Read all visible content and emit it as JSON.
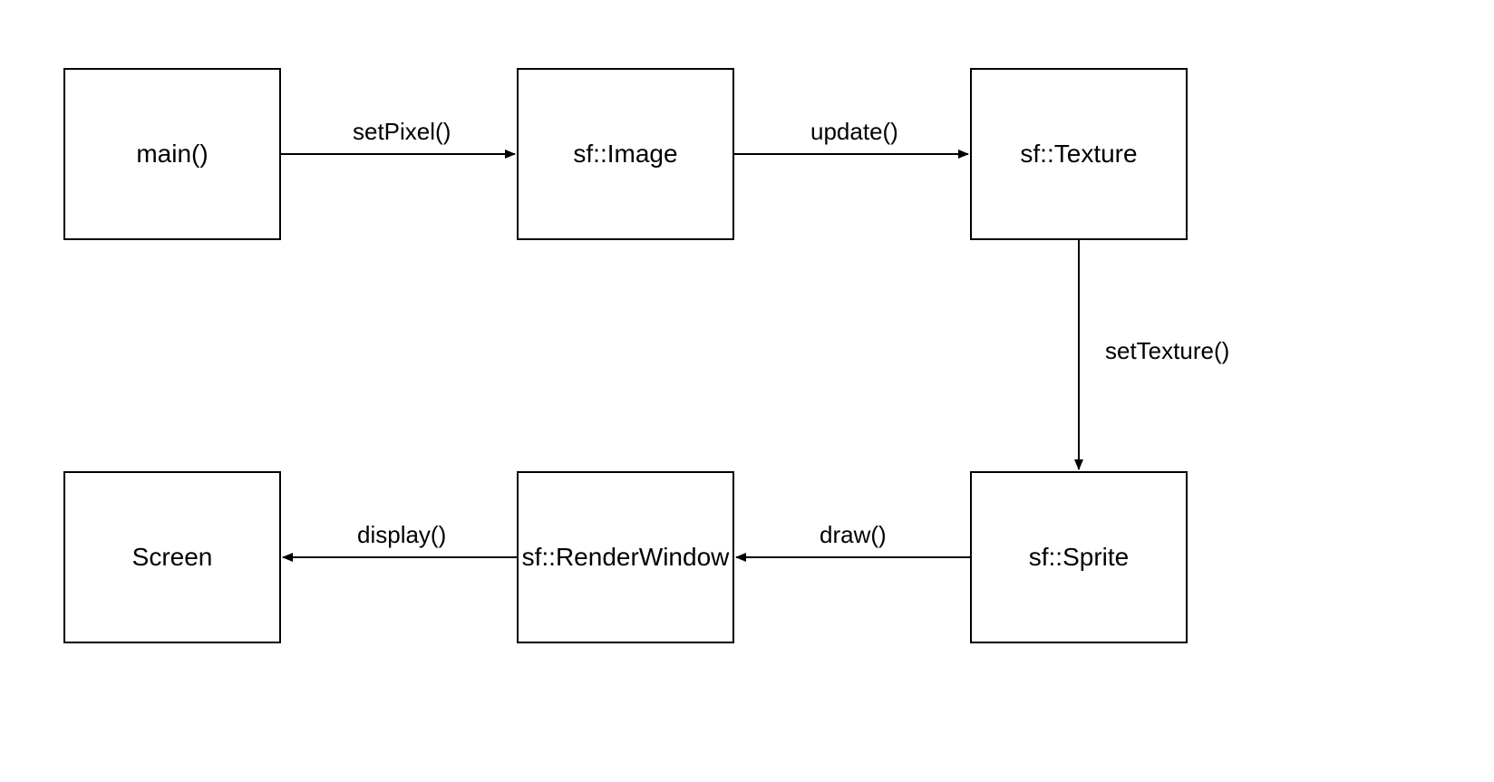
{
  "nodes": {
    "main": {
      "label": "main()"
    },
    "image": {
      "label": "sf::Image"
    },
    "texture": {
      "label": "sf::Texture"
    },
    "sprite": {
      "label": "sf::Sprite"
    },
    "renderwindow": {
      "label": "sf::RenderWindow"
    },
    "screen": {
      "label": "Screen"
    }
  },
  "edges": {
    "setpixel": {
      "label": "setPixel()"
    },
    "update": {
      "label": "update()"
    },
    "settexture": {
      "label": "setTexture()"
    },
    "draw": {
      "label": "draw()"
    },
    "display": {
      "label": "display()"
    }
  }
}
